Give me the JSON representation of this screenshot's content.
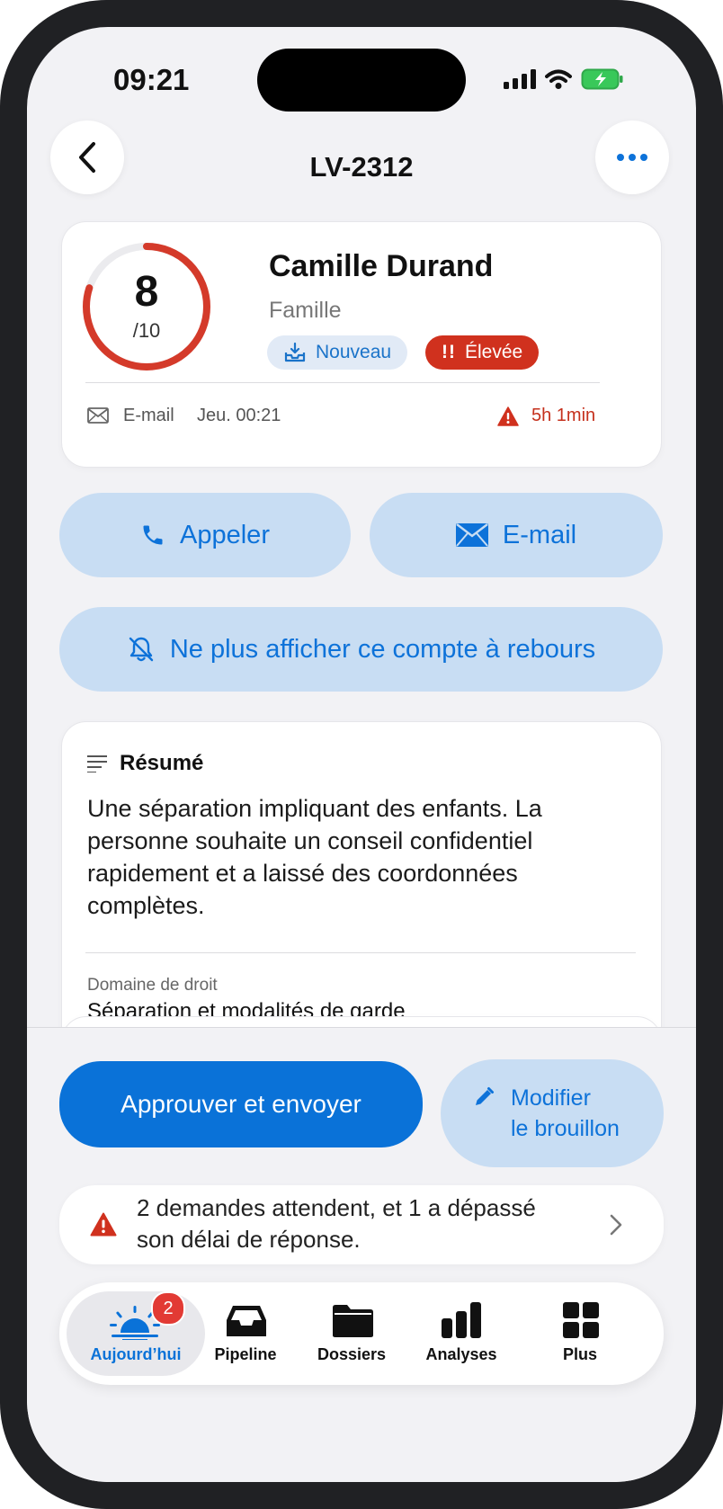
{
  "status_bar": {
    "time": "09:21"
  },
  "nav": {
    "title": "LV-2312"
  },
  "lead": {
    "score": "8",
    "score_scale": "/10",
    "score_fraction": 0.8,
    "name": "Camille Durand",
    "category": "Famille",
    "badge_new": "Nouveau",
    "badge_priority": "Élevée",
    "channel": "E-mail",
    "received": "Jeu. 00:21",
    "time_left": "5h 1min"
  },
  "actions": {
    "call": "Appeler",
    "email": "E-mail",
    "mute_countdown": "Ne plus afficher ce compte à rebours"
  },
  "summary": {
    "title": "Résumé",
    "text": "Une séparation impliquant des enfants. La personne souhaite un conseil confidentiel rapidement et a laissé des coordonnées complètes.",
    "field_label": "Domaine de droit",
    "field_value": "Séparation et modalités de garde"
  },
  "footer": {
    "approve": "Approuver et envoyer",
    "edit_line1": "Modifier",
    "edit_line2": "le brouillon",
    "alert_line1": "2 demandes attendent, et 1 a dépassé",
    "alert_line2": "son délai de réponse."
  },
  "tabs": [
    {
      "label": "Aujourd’hui",
      "badge": "2",
      "icon": "sunrise-icon",
      "active": true
    },
    {
      "label": "Pipeline",
      "icon": "inbox-tray-icon"
    },
    {
      "label": "Dossiers",
      "icon": "folder-icon"
    },
    {
      "label": "Analyses",
      "icon": "bar-chart-icon"
    },
    {
      "label": "Plus",
      "icon": "grid-icon"
    }
  ],
  "colors": {
    "accent": "#0a72d8",
    "danger": "#d0311e",
    "score_ring": "#d43a2a"
  }
}
